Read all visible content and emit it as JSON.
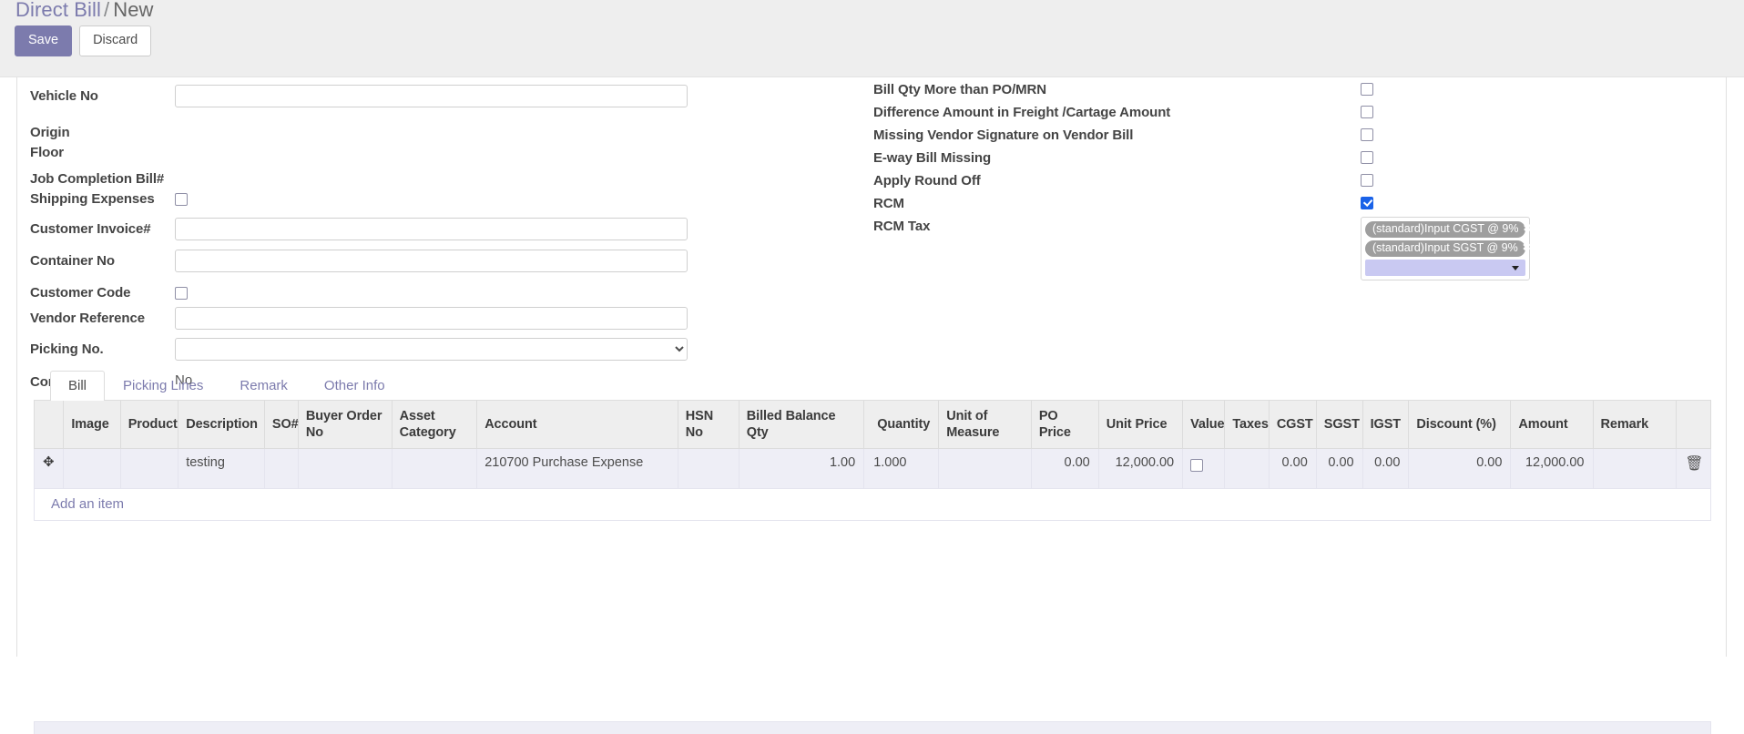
{
  "header": {
    "breadcrumb_root": "Direct Bill",
    "breadcrumb_separator": "/",
    "breadcrumb_current": "New",
    "save_label": "Save",
    "discard_label": "Discard"
  },
  "form": {
    "left_fields": [
      {
        "label": "Vehicle No",
        "type": "text",
        "value": ""
      },
      {
        "label": "Origin",
        "type": "blank",
        "value": ""
      },
      {
        "label": "Floor",
        "type": "blank",
        "value": ""
      },
      {
        "label": "Job Completion Bill#",
        "type": "blank",
        "value": ""
      },
      {
        "label": "Shipping Expenses",
        "type": "checkbox",
        "checked": false
      },
      {
        "label": "Customer Invoice#",
        "type": "text",
        "value": ""
      },
      {
        "label": "Container No",
        "type": "text",
        "value": ""
      },
      {
        "label": "Customer Code",
        "type": "checkbox",
        "checked": false
      },
      {
        "label": "Vendor Reference",
        "type": "text",
        "value": ""
      },
      {
        "label": "Picking No.",
        "type": "select",
        "value": ""
      },
      {
        "label": "Composite",
        "type": "static",
        "value": "No"
      }
    ],
    "right_fields": [
      {
        "label": "Bill Qty More than PO/MRN",
        "type": "checkbox",
        "checked": false
      },
      {
        "label": "Difference Amount in Freight /Cartage Amount",
        "type": "checkbox",
        "checked": false
      },
      {
        "label": "Missing Vendor Signature on Vendor Bill",
        "type": "checkbox",
        "checked": false
      },
      {
        "label": "E-way Bill Missing",
        "type": "checkbox",
        "checked": false
      },
      {
        "label": "Apply Round Off",
        "type": "checkbox",
        "checked": false
      },
      {
        "label": "RCM",
        "type": "checkbox",
        "checked": true
      }
    ],
    "rcm_tax": {
      "label": "RCM Tax",
      "tags": [
        "(standard)Input CGST @ 9%",
        "(standard)Input SGST @ 9%"
      ],
      "remove_glyph": "✖",
      "input_value": ""
    }
  },
  "notebook": {
    "tabs": [
      {
        "label": "Bill",
        "active": true
      },
      {
        "label": "Picking Lines",
        "active": false
      },
      {
        "label": "Remark",
        "active": false
      },
      {
        "label": "Other Info",
        "active": false
      }
    ]
  },
  "lines_table": {
    "columns": [
      "",
      "Image",
      "Product",
      "Description",
      "SO#",
      "Buyer Order No",
      "Asset Category",
      "Account",
      "HSN No",
      "Billed Balance Qty",
      "Quantity",
      "Unit of Measure",
      "PO Price",
      "Unit Price",
      "Value",
      "Taxes",
      "CGST",
      "SGST",
      "IGST",
      "Discount (%)",
      "Amount",
      "Remark",
      ""
    ],
    "rows": [
      {
        "handle": "✥",
        "image": "",
        "product": "",
        "description": "testing",
        "so_no": "",
        "buyer_order_no": "",
        "asset_category": "",
        "account": "210700 Purchase Expense",
        "hsn_no": "",
        "billed_balance_qty": "1.00",
        "quantity": "1.000",
        "unit_of_measure": "",
        "po_price": "0.00",
        "unit_price": "12,000.00",
        "value_checked": false,
        "taxes": "",
        "cgst": "0.00",
        "sgst": "0.00",
        "igst": "0.00",
        "discount_pct": "0.00",
        "amount": "12,000.00",
        "remark": "",
        "delete_glyph": "🗑"
      }
    ],
    "add_item_label": "Add an item"
  },
  "colors": {
    "accent": "#7c7bad",
    "checkbox_checked": "#1a62e8",
    "row_background": "#eeeef6",
    "header_background": "#eeeeee",
    "tag_background": "#9e9e9e",
    "tag_input_background": "#c9c9f2"
  }
}
